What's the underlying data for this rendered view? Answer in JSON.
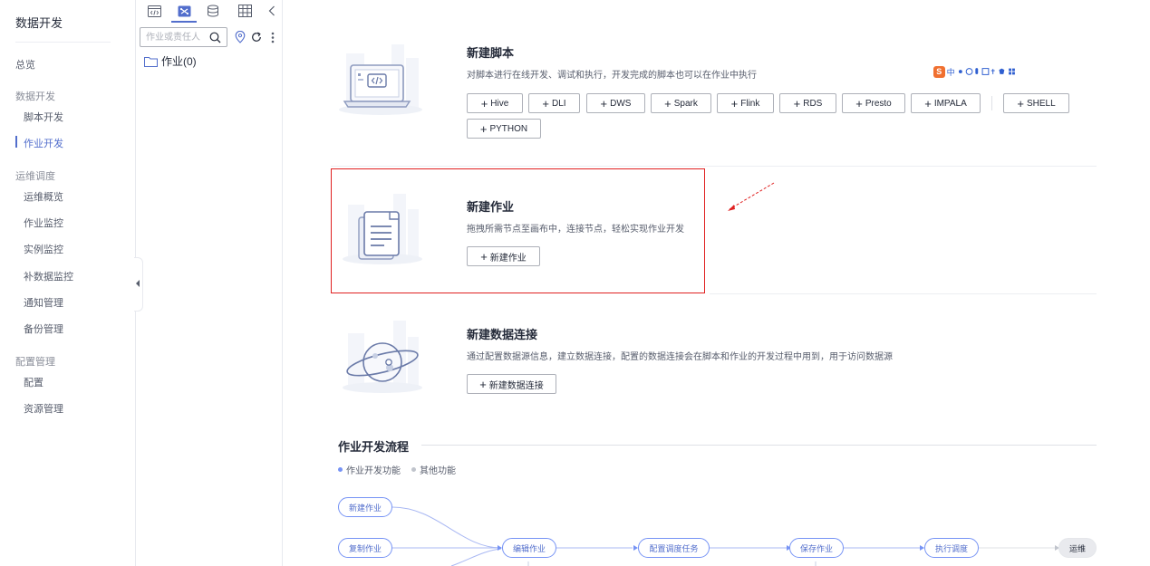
{
  "nav": {
    "title": "数据开发",
    "overview": "总览",
    "group_dev": "数据开发",
    "script_dev": "脚本开发",
    "job_dev": "作业开发",
    "group_ops": "运维调度",
    "ops_overview": "运维概览",
    "job_monitor": "作业监控",
    "instance_monitor": "实例监控",
    "patch_monitor": "补数据监控",
    "notify_mgmt": "通知管理",
    "backup_mgmt": "备份管理",
    "group_config": "配置管理",
    "config": "配置",
    "resource_mgmt": "资源管理"
  },
  "tree": {
    "search_placeholder": "作业或责任人",
    "root_node": "作业(0)"
  },
  "ime": {
    "logo": "S",
    "lang": "中"
  },
  "script_card": {
    "title": "新建脚本",
    "desc": "对脚本进行在线开发、调试和执行，开发完成的脚本也可以在作业中执行",
    "buttons": [
      "Hive",
      "DLI",
      "DWS",
      "Spark",
      "Flink",
      "RDS",
      "Presto",
      "IMPALA",
      "SHELL",
      "PYTHON"
    ]
  },
  "job_card": {
    "title": "新建作业",
    "desc": "拖拽所需节点至画布中，连接节点，轻松实现作业开发",
    "button": "新建作业"
  },
  "conn_card": {
    "title": "新建数据连接",
    "desc": "通过配置数据源信息，建立数据连接，配置的数据连接会在脚本和作业的开发过程中用到，用于访问数据源",
    "button": "新建数据连接"
  },
  "flow": {
    "title": "作业开发流程",
    "legend_main": "作业开发功能",
    "legend_other": "其他功能",
    "nodes": {
      "new_job": "新建作业",
      "copy_job": "复制作业",
      "edit_job": "编辑作业",
      "config_schedule": "配置调度任务",
      "save_job": "保存作业",
      "run_schedule": "执行调度",
      "ops": "运维"
    }
  },
  "colors": {
    "accent": "#526ecc",
    "highlight_border": "#e02020",
    "flow_node_border": "#7693f5",
    "legend_main_dot": "#7693f5",
    "legend_other_dot": "#c0c4cc"
  }
}
